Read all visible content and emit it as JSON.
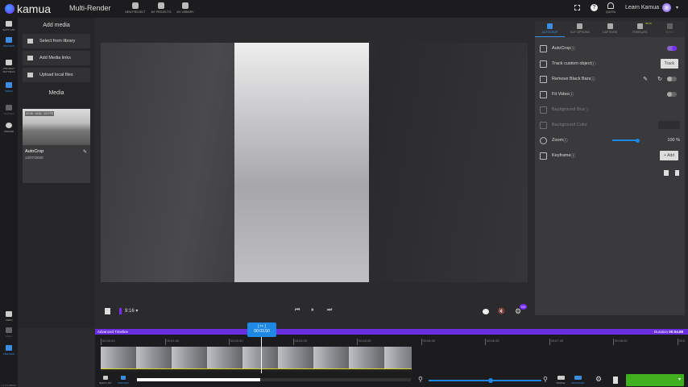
{
  "header": {
    "app": "kamua",
    "title": "Multi-Render",
    "nav": [
      {
        "label": "NEW PROJECT",
        "icon": "plus-circle-icon"
      },
      {
        "label": "MY PROJECTS",
        "icon": "projects-icon"
      },
      {
        "label": "MY LIBRARY",
        "icon": "library-icon"
      }
    ],
    "quota": "QUOTA",
    "learn": "Learn Kamua"
  },
  "rail": {
    "items": [
      "SHOT LIST",
      "PREVIEW",
      "PROJECT SETTINGS",
      "MEDIA",
      "RENDER",
      "WIZARD"
    ],
    "bottom": [
      "UNDO",
      "REDO",
      "PREVIEW"
    ],
    "version": "v 2.7.0-PROD"
  },
  "media_panel": {
    "add_title": "Add media",
    "buttons": [
      "Select from library",
      "Add Media links",
      "Upload local files"
    ],
    "media_title": "Media",
    "card": {
      "meta": "00:06 · UHD · 29 FPS",
      "name": "AutoCrop",
      "date": "12/07/2020"
    }
  },
  "right_panel": {
    "tabs": [
      "AUTOCROP",
      "CUT OPTIONS",
      "CAPTIONS",
      "OVERLAYS",
      "MUSIC"
    ],
    "beta": "BETA",
    "rows": [
      {
        "label": "AutoCrop"
      },
      {
        "label": "Track custom object",
        "button": "Track"
      },
      {
        "label": "Remove Black Bars"
      },
      {
        "label": "Fit Video"
      },
      {
        "label": "Background Blur"
      },
      {
        "label": "Background Color"
      },
      {
        "label": "Zoom",
        "value": "100 %",
        "level": 1.0
      },
      {
        "label": "Keyframe",
        "button": "+ Add"
      }
    ]
  },
  "controls": {
    "aspect": "9:16",
    "badge": "HD"
  },
  "timeline": {
    "title": "Advanced Timeline",
    "duration_label": "Duration",
    "duration": "00:04.88",
    "playhead": "00:03.50",
    "ticks": [
      "00:00.00",
      "00:01.00",
      "00:02.00",
      "00:03.00",
      "00:04.00",
      "00:05.00",
      "00:06.00",
      "00:07.00",
      "00:08.00",
      "00:0"
    ],
    "bottom": [
      "SHOT LIST",
      "PREVIEW",
      "SIMPLE",
      "ADVANCED"
    ],
    "scroll_fraction": 0.45,
    "zoom_level": 0.55
  }
}
